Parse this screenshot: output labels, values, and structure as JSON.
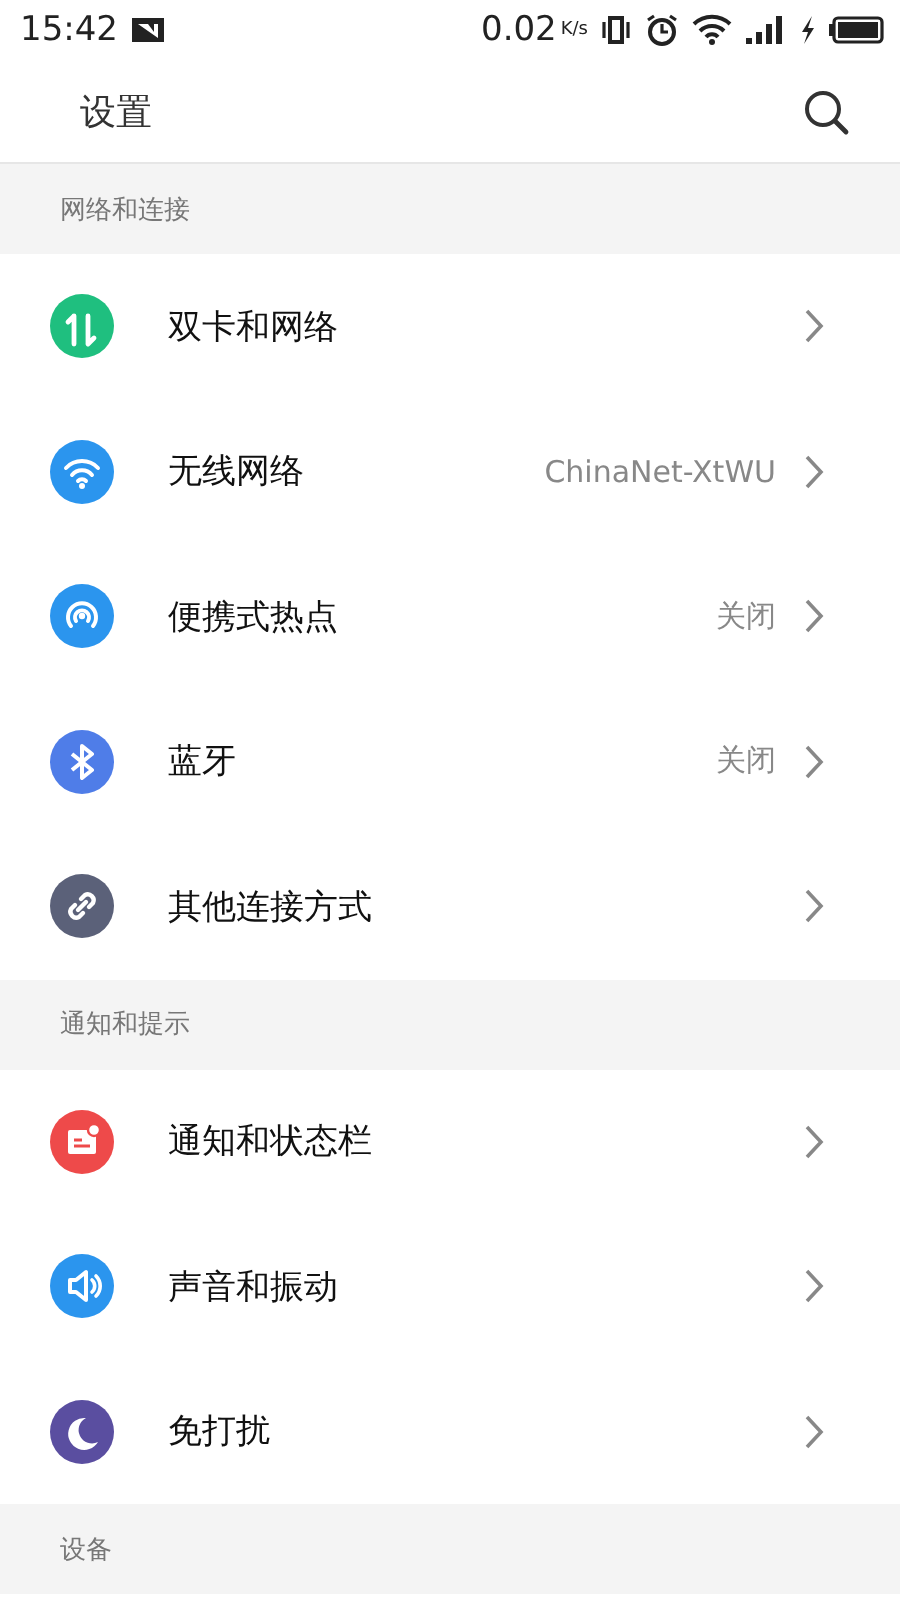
{
  "status_bar": {
    "time": "15:42",
    "speed": "0.02",
    "speed_unit": "K/s"
  },
  "header": {
    "title": "设置"
  },
  "sections": [
    {
      "title": "网络和连接",
      "items": [
        {
          "kind": "sim",
          "color": "#1fbf7f",
          "label": "双卡和网络"
        },
        {
          "kind": "wifi",
          "color": "#2b95ee",
          "label": "无线网络",
          "value": "ChinaNet-XtWU"
        },
        {
          "kind": "hotspot",
          "color": "#2b95ee",
          "label": "便携式热点",
          "value": "关闭"
        },
        {
          "kind": "bluetooth",
          "color": "#4f7de8",
          "label": "蓝牙",
          "value": "关闭"
        },
        {
          "kind": "link",
          "color": "#5b6179",
          "label": "其他连接方式"
        }
      ]
    },
    {
      "title": "通知和提示",
      "items": [
        {
          "kind": "notification",
          "color": "#ee4a4a",
          "label": "通知和状态栏"
        },
        {
          "kind": "sound",
          "color": "#2b95ee",
          "label": "声音和振动"
        },
        {
          "kind": "moon",
          "color": "#5a4ea0",
          "label": "免打扰"
        }
      ]
    },
    {
      "title": "设备"
    }
  ]
}
